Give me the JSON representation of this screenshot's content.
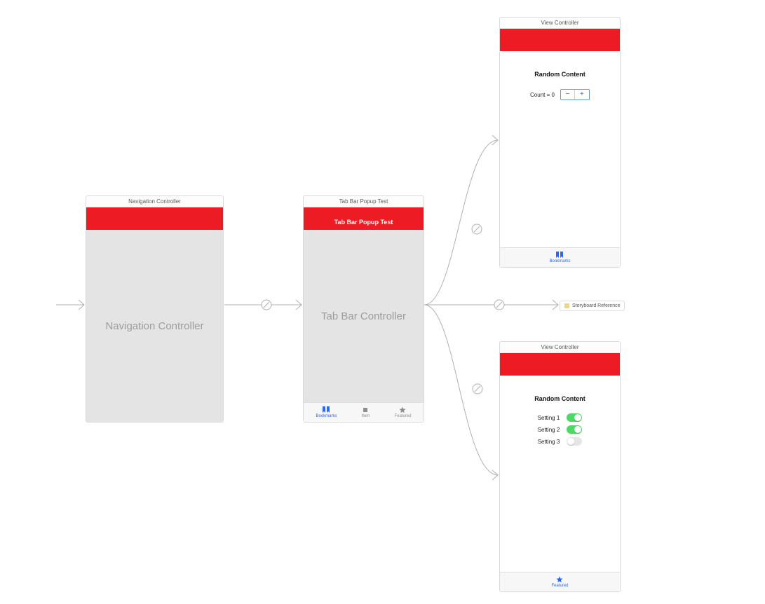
{
  "scenes": {
    "nav": {
      "title": "Navigation Controller",
      "body_label": "Navigation Controller"
    },
    "tabbar": {
      "title": "Tab Bar Popup Test",
      "nav_title": "Tab Bar Popup Test",
      "body_label": "Tab Bar Controller",
      "tabs": {
        "bookmarks": "Bookmarks",
        "item": "Item",
        "featured": "Featured"
      }
    },
    "vc1": {
      "title": "View Controller",
      "section_title": "Random Content",
      "count_label": "Count = 0",
      "tab_label": "Bookmarks"
    },
    "vc2": {
      "title": "View Controller",
      "section_title": "Random Content",
      "settings": {
        "s1": {
          "label": "Setting 1",
          "on": true
        },
        "s2": {
          "label": "Setting 2",
          "on": true
        },
        "s3": {
          "label": "Setting 3",
          "on": false
        }
      },
      "tab_label": "Featured"
    }
  },
  "storyboard_ref": "Storyboard Reference"
}
